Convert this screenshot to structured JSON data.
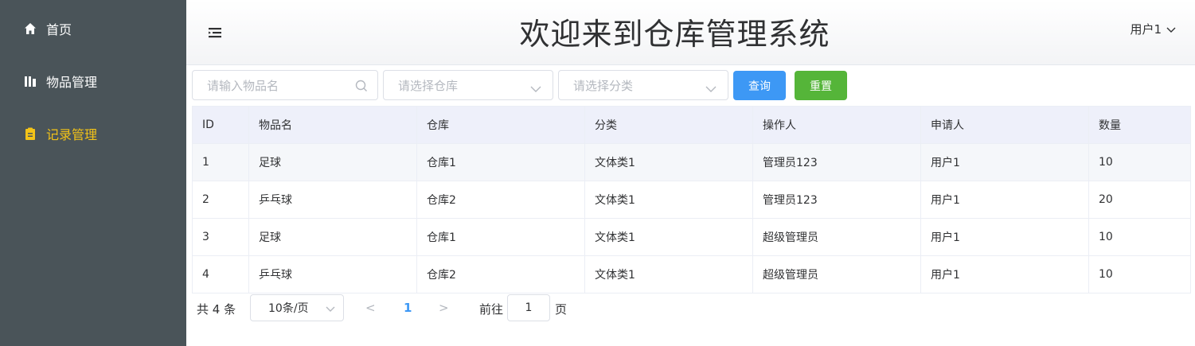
{
  "sidebar": {
    "items": [
      {
        "label": "首页",
        "icon": "home-icon"
      },
      {
        "label": "物品管理",
        "icon": "bars-icon"
      },
      {
        "label": "记录管理",
        "icon": "clipboard-icon"
      }
    ],
    "active_color": "#f3c318",
    "background": "#4a5459"
  },
  "header": {
    "title": "欢迎来到仓库管理系统",
    "user": "用户1"
  },
  "search": {
    "name_placeholder": "请输入物品名",
    "warehouse_placeholder": "请选择仓库",
    "category_placeholder": "请选择分类",
    "query_label": "查询",
    "reset_label": "重置"
  },
  "table": {
    "columns": [
      "ID",
      "物品名",
      "仓库",
      "分类",
      "操作人",
      "申请人",
      "数量"
    ],
    "rows": [
      [
        "1",
        "足球",
        "仓库1",
        "文体类1",
        "管理员123",
        "用户1",
        "10"
      ],
      [
        "2",
        "乒乓球",
        "仓库2",
        "文体类1",
        "管理员123",
        "用户1",
        "20"
      ],
      [
        "3",
        "足球",
        "仓库1",
        "文体类1",
        "超级管理员",
        "用户1",
        "10"
      ],
      [
        "4",
        "乒乓球",
        "仓库2",
        "文体类1",
        "超级管理员",
        "用户1",
        "10"
      ]
    ]
  },
  "pagination": {
    "total": "共 4 条",
    "page_size": "10条/页",
    "prev": "<",
    "current": "1",
    "next": ">",
    "goto_label": "前往",
    "goto_value": "1",
    "page_suffix": "页"
  },
  "colors": {
    "primary": "#3d98f5",
    "success": "#55b539"
  }
}
